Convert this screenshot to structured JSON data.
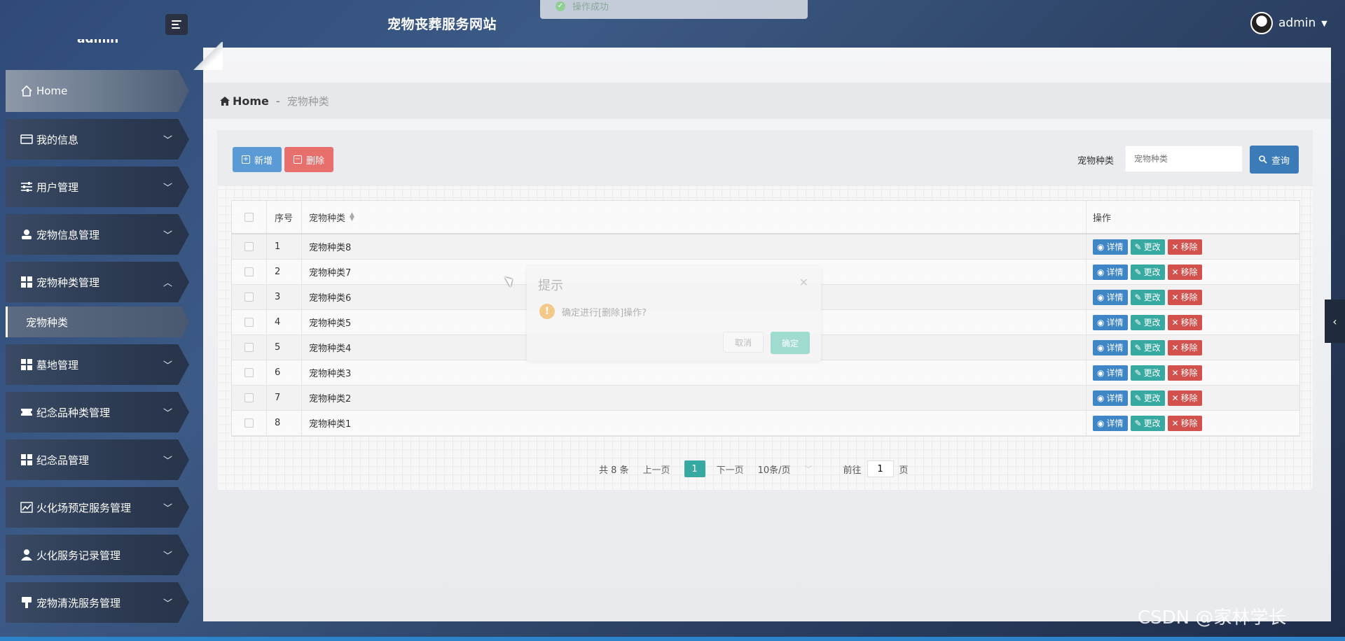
{
  "app": {
    "site_title": "宠物丧葬服务网站",
    "toast": "操作成功",
    "user_name": "admin",
    "sidebar_user": "admin",
    "watermark": "CSDN @家林学长"
  },
  "sidebar": {
    "items": [
      {
        "label": "Home",
        "icon": "home-icon"
      },
      {
        "label": "我的信息",
        "icon": "wallet-icon"
      },
      {
        "label": "用户管理",
        "icon": "sliders-icon"
      },
      {
        "label": "宠物信息管理",
        "icon": "user-icon"
      },
      {
        "label": "宠物种类管理",
        "icon": "grid-icon"
      },
      {
        "label": "宠物种类",
        "icon": ""
      },
      {
        "label": "墓地管理",
        "icon": "grid-icon"
      },
      {
        "label": "纪念品种类管理",
        "icon": "ticket-icon"
      },
      {
        "label": "纪念品管理",
        "icon": "grid-icon"
      },
      {
        "label": "火化场预定服务管理",
        "icon": "chart-icon"
      },
      {
        "label": "火化服务记录管理",
        "icon": "user-icon"
      },
      {
        "label": "宠物清洗服务管理",
        "icon": "brush-icon"
      }
    ]
  },
  "breadcrumb": {
    "home": "Home",
    "sep": "-",
    "current": "宠物种类"
  },
  "toolbar": {
    "add_label": "新增",
    "delete_label": "删除",
    "search_label": "宠物种类",
    "search_placeholder": "宠物种类",
    "search_button": "查询"
  },
  "table": {
    "headers": {
      "no": "序号",
      "name": "宠物种类",
      "ops": "操作"
    },
    "op_labels": {
      "detail": "详情",
      "edit": "更改",
      "remove": "移除"
    },
    "rows": [
      {
        "no": "1",
        "name": "宠物种类8"
      },
      {
        "no": "2",
        "name": "宠物种类7"
      },
      {
        "no": "3",
        "name": "宠物种类6"
      },
      {
        "no": "4",
        "name": "宠物种类5"
      },
      {
        "no": "5",
        "name": "宠物种类4"
      },
      {
        "no": "6",
        "name": "宠物种类3"
      },
      {
        "no": "7",
        "name": "宠物种类2"
      },
      {
        "no": "8",
        "name": "宠物种类1"
      }
    ]
  },
  "pager": {
    "total": "共 8 条",
    "prev": "上一页",
    "current": "1",
    "next": "下一页",
    "size": "10条/页",
    "goto_label": "前往",
    "goto_value": "1",
    "page_unit": "页"
  },
  "modal": {
    "title": "提示",
    "message": "确定进行[删除]操作?",
    "cancel": "取消",
    "ok": "确定"
  },
  "colors": {
    "primary": "#5b9bd5",
    "danger": "#e8706c",
    "teal": "#36a9a0",
    "search": "#3b7bb8"
  }
}
